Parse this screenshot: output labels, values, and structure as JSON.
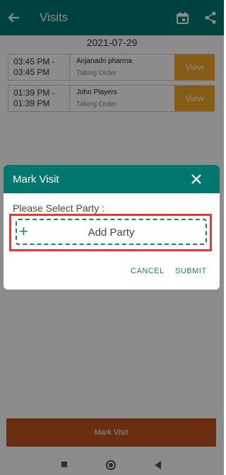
{
  "appbar": {
    "title": "Visits",
    "back_icon": "arrow-left-icon",
    "calendar_icon": "calendar-icon",
    "share_icon": "share-icon"
  },
  "date": "2021-07-29",
  "visits": [
    {
      "time": "03:45 PM -\n03:45 PM",
      "party": "Anjanadri pharma",
      "status": "Taking Order",
      "button": "View"
    },
    {
      "time": "01:39 PM -\n01:39 PM",
      "party": "John Players",
      "status": "Taking Order",
      "button": "View"
    }
  ],
  "footer": {
    "button_label": "Mark Visit"
  },
  "dialog": {
    "title": "Mark Visit",
    "label": "Please Select Party :",
    "add_party_label": "Add Party",
    "plus_icon": "+",
    "cancel_label": "CANCEL",
    "submit_label": "SUBMIT"
  },
  "colors": {
    "primary": "#00786f",
    "view_button": "#f5a623",
    "mark_visit_button": "#c1531c",
    "highlight": "#e53935"
  }
}
